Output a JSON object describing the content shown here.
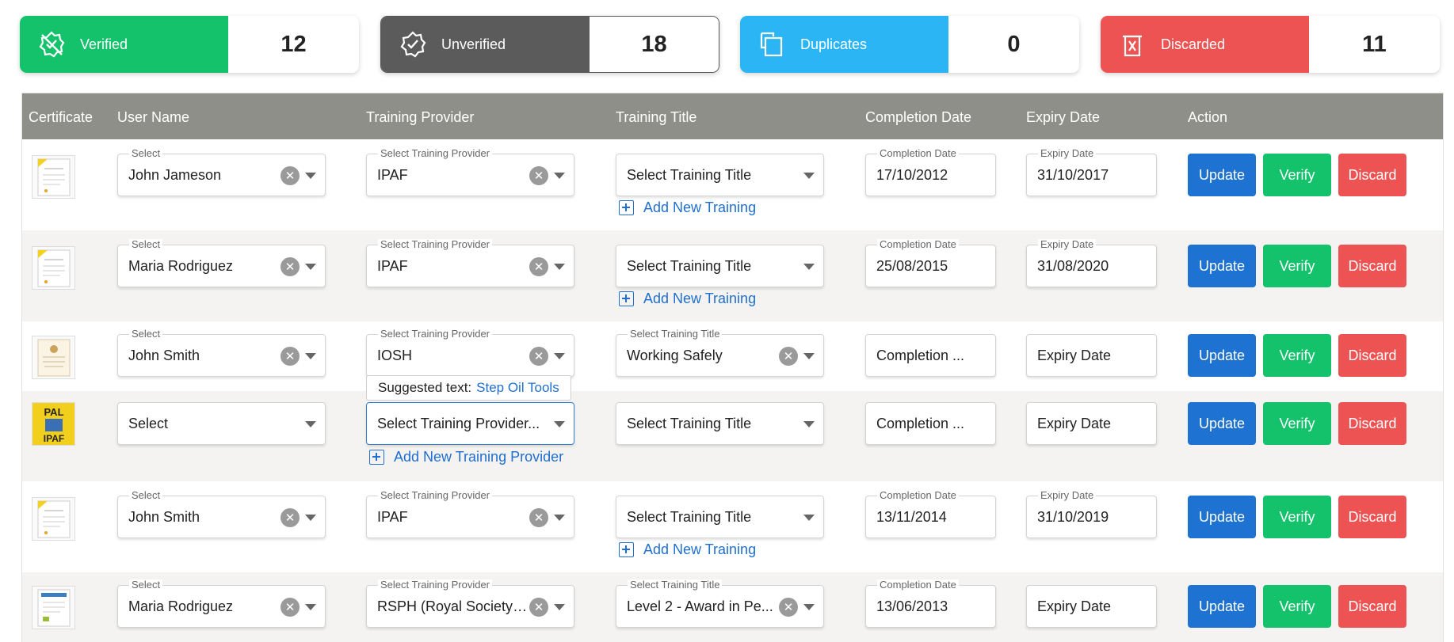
{
  "stats": [
    {
      "label": "Verified",
      "count": "12",
      "color": "#13c26b",
      "icon": "verified-badge-icon"
    },
    {
      "label": "Unverified",
      "count": "18",
      "color": "#5b5b5b",
      "icon": "check-badge-icon"
    },
    {
      "label": "Duplicates",
      "count": "0",
      "color": "#2bb5f5",
      "icon": "copy-icon"
    },
    {
      "label": "Discarded",
      "count": "11",
      "color": "#ee5353",
      "icon": "trash-icon"
    }
  ],
  "headers": {
    "certificate": "Certificate",
    "user_name": "User Name",
    "training_provider": "Training Provider",
    "training_title": "Training Title",
    "completion_date": "Completion Date",
    "expiry_date": "Expiry Date",
    "action": "Action"
  },
  "actions": {
    "update": "Update",
    "verify": "Verify",
    "discard": "Discard"
  },
  "add_new_training": "Add New Training",
  "add_new_training_provider": "Add New Training Provider",
  "tooltip": {
    "prefix": "Suggested text:",
    "suggestion": "Step Oil Tools"
  },
  "rows": [
    {
      "user": {
        "caption": "Select",
        "value": "John Jameson"
      },
      "provider": {
        "caption": "Select Training Provider",
        "value": "IPAF"
      },
      "title": {
        "caption": "",
        "value": "Select Training Title"
      },
      "completion": {
        "caption": "Completion Date",
        "value": "17/10/2012"
      },
      "expiry": {
        "caption": "Expiry Date",
        "value": "31/10/2017"
      }
    },
    {
      "user": {
        "caption": "Select",
        "value": "Maria Rodriguez"
      },
      "provider": {
        "caption": "Select Training Provider",
        "value": "IPAF"
      },
      "title": {
        "caption": "",
        "value": "Select Training Title"
      },
      "completion": {
        "caption": "Completion Date",
        "value": "25/08/2015"
      },
      "expiry": {
        "caption": "Expiry Date",
        "value": "31/08/2020"
      }
    },
    {
      "user": {
        "caption": "Select",
        "value": "John Smith"
      },
      "provider": {
        "caption": "Select Training Provider",
        "value": "IOSH"
      },
      "title": {
        "caption": "Select Training Title",
        "value": "Working Safely"
      },
      "completion": {
        "caption": "",
        "value": "Completion ..."
      },
      "expiry": {
        "caption": "",
        "value": "Expiry Date"
      }
    },
    {
      "user": {
        "caption": "",
        "value": "Select"
      },
      "provider": {
        "caption": "",
        "value": "Select Training Provider..."
      },
      "title": {
        "caption": "",
        "value": "Select Training Title"
      },
      "completion": {
        "caption": "",
        "value": "Completion ..."
      },
      "expiry": {
        "caption": "",
        "value": "Expiry Date"
      }
    },
    {
      "user": {
        "caption": "Select",
        "value": "John Smith"
      },
      "provider": {
        "caption": "Select Training Provider",
        "value": "IPAF"
      },
      "title": {
        "caption": "",
        "value": "Select Training Title"
      },
      "completion": {
        "caption": "Completion Date",
        "value": "13/11/2014"
      },
      "expiry": {
        "caption": "Expiry Date",
        "value": "31/10/2019"
      }
    },
    {
      "user": {
        "caption": "Select",
        "value": "Maria Rodriguez"
      },
      "provider": {
        "caption": "Select Training Provider",
        "value": "RSPH (Royal Society ..."
      },
      "title": {
        "caption": "Select Training Title",
        "value": "Level 2 - Award in Pe..."
      },
      "completion": {
        "caption": "Completion Date",
        "value": "13/06/2013"
      },
      "expiry": {
        "caption": "",
        "value": "Expiry Date"
      }
    }
  ]
}
